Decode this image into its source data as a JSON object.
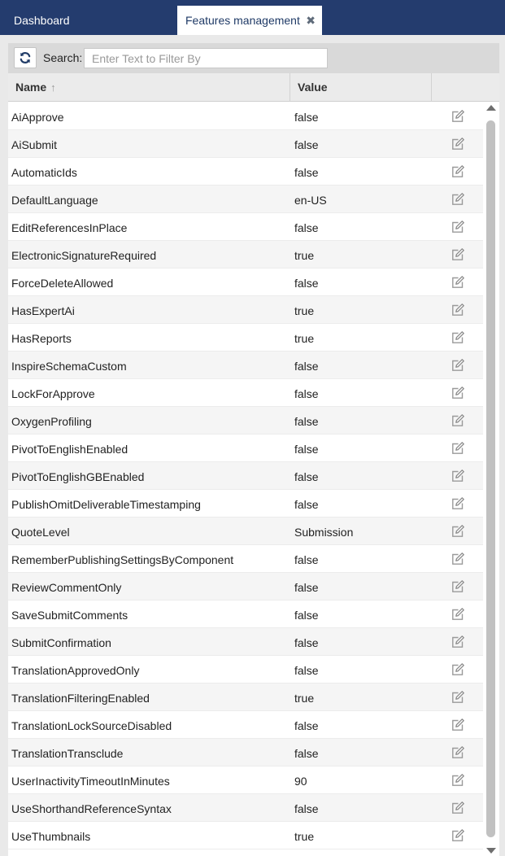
{
  "tabs": {
    "dashboard_label": "Dashboard",
    "active_label": "Features management",
    "close_glyph": "✖"
  },
  "toolbar": {
    "refresh_icon": "refresh-icon",
    "search_label": "Search:",
    "search_value": "",
    "search_placeholder": "Enter Text to Filter By"
  },
  "grid": {
    "columns": {
      "name": "Name",
      "value": "Value",
      "actions": ""
    },
    "sort_glyph": "↑",
    "edit_icon": "edit-icon",
    "rows": [
      {
        "name": "AiApprove",
        "value": "false"
      },
      {
        "name": "AiSubmit",
        "value": "false"
      },
      {
        "name": "AutomaticIds",
        "value": "false"
      },
      {
        "name": "DefaultLanguage",
        "value": "en-US"
      },
      {
        "name": "EditReferencesInPlace",
        "value": "false"
      },
      {
        "name": "ElectronicSignatureRequired",
        "value": "true"
      },
      {
        "name": "ForceDeleteAllowed",
        "value": "false"
      },
      {
        "name": "HasExpertAi",
        "value": "true"
      },
      {
        "name": "HasReports",
        "value": "true"
      },
      {
        "name": "InspireSchemaCustom",
        "value": "false"
      },
      {
        "name": "LockForApprove",
        "value": "false"
      },
      {
        "name": "OxygenProfiling",
        "value": "false"
      },
      {
        "name": "PivotToEnglishEnabled",
        "value": "false"
      },
      {
        "name": "PivotToEnglishGBEnabled",
        "value": "false"
      },
      {
        "name": "PublishOmitDeliverableTimestamping",
        "value": "false"
      },
      {
        "name": "QuoteLevel",
        "value": "Submission"
      },
      {
        "name": "RememberPublishingSettingsByComponent",
        "value": "false"
      },
      {
        "name": "ReviewCommentOnly",
        "value": "false"
      },
      {
        "name": "SaveSubmitComments",
        "value": "false"
      },
      {
        "name": "SubmitConfirmation",
        "value": "false"
      },
      {
        "name": "TranslationApprovedOnly",
        "value": "false"
      },
      {
        "name": "TranslationFilteringEnabled",
        "value": "true"
      },
      {
        "name": "TranslationLockSourceDisabled",
        "value": "false"
      },
      {
        "name": "TranslationTransclude",
        "value": "false"
      },
      {
        "name": "UserInactivityTimeoutInMinutes",
        "value": "90"
      },
      {
        "name": "UseShorthandReferenceSyntax",
        "value": "false"
      },
      {
        "name": "UseThumbnails",
        "value": "true"
      }
    ]
  },
  "colors": {
    "tabbar": "#243c6e",
    "active_tab_text": "#1f3a66",
    "toolbar": "#d9d9d9",
    "refresh_icon": "#1f3a66"
  }
}
